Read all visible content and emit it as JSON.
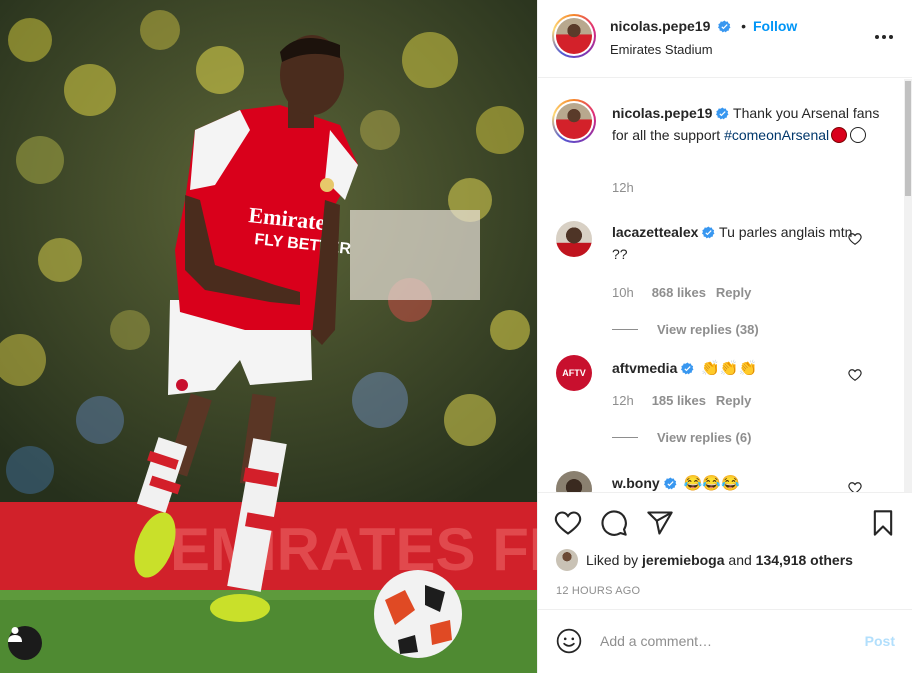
{
  "post_author": {
    "username": "nicolas.pepe19",
    "follow_label": "Follow",
    "location": "Emirates Stadium"
  },
  "caption": {
    "username": "nicolas.pepe19",
    "text": "Thank you Arsenal fans for all the support",
    "hashtag": "#comeonArsenal",
    "time": "12h"
  },
  "comments": [
    {
      "username": "lacazettealex",
      "text": "Tu parles anglais mtn ??",
      "time": "10h",
      "likes": "868 likes",
      "reply_label": "Reply",
      "view_replies": "View replies (38)"
    },
    {
      "username": "aftvmedia",
      "text": "👏👏👏",
      "time": "12h",
      "likes": "185 likes",
      "reply_label": "Reply",
      "view_replies": "View replies (6)",
      "avatar_text": "AFTV"
    },
    {
      "username": "w.bony",
      "text": "😂😂😂"
    }
  ],
  "likes_summary": {
    "prefix": "Liked by",
    "user": "jeremieboga",
    "middle": "and",
    "others": "134,918 others"
  },
  "timestamp": "12 HOURS AGO",
  "comment_box": {
    "placeholder": "Add a comment…",
    "post_label": "Post"
  },
  "colors": {
    "accent": "#0095f6",
    "verified": "#3897f0",
    "post_disabled": "#b2dffc",
    "arsenal_red": "#d9001b"
  },
  "icons": {
    "more": "more-horizontal-icon",
    "like": "heart-icon",
    "comment": "comment-bubble-icon",
    "share": "paper-plane-icon",
    "save": "bookmark-icon",
    "emoji": "smiley-icon",
    "tag_user": "user-tag-icon",
    "verified": "verified-badge-icon"
  }
}
